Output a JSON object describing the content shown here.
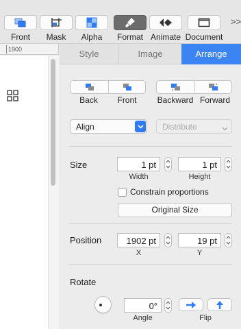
{
  "toolbar": {
    "items": [
      {
        "label": "Front",
        "icon": "bring-to-front-icon"
      },
      {
        "label": "Mask",
        "icon": "mask-icon"
      },
      {
        "label": "Alpha",
        "icon": "alpha-icon"
      },
      {
        "label": "Format",
        "icon": "format-icon",
        "active": true
      },
      {
        "label": "Animate",
        "icon": "animate-icon"
      },
      {
        "label": "Document",
        "icon": "document-icon"
      }
    ],
    "overflow": ">>"
  },
  "ruler": {
    "label": "1900"
  },
  "inspector": {
    "tabs": [
      {
        "label": "Style",
        "active": false
      },
      {
        "label": "Image",
        "active": false
      },
      {
        "label": "Arrange",
        "active": true
      }
    ],
    "order": {
      "back": "Back",
      "front": "Front",
      "backward": "Backward",
      "forward": "Forward"
    },
    "align": {
      "value": "Align"
    },
    "distribute": {
      "value": "Distribute"
    },
    "size": {
      "label": "Size",
      "width": "1 pt",
      "height": "1 pt",
      "width_caption": "Width",
      "height_caption": "Height",
      "constrain_label": "Constrain proportions",
      "constrain_checked": false,
      "original_size_label": "Original Size"
    },
    "position": {
      "label": "Position",
      "x": "1902 pt",
      "y": "19 pt",
      "x_caption": "X",
      "y_caption": "Y"
    },
    "rotate": {
      "label": "Rotate",
      "angle": "0°",
      "angle_caption": "Angle",
      "flip_caption": "Flip"
    }
  },
  "colors": {
    "accent": "#3b84f3",
    "tab_bg": "#e2e2e2",
    "panel_bg": "#ececec",
    "active_tool": "#6c6c6c"
  }
}
